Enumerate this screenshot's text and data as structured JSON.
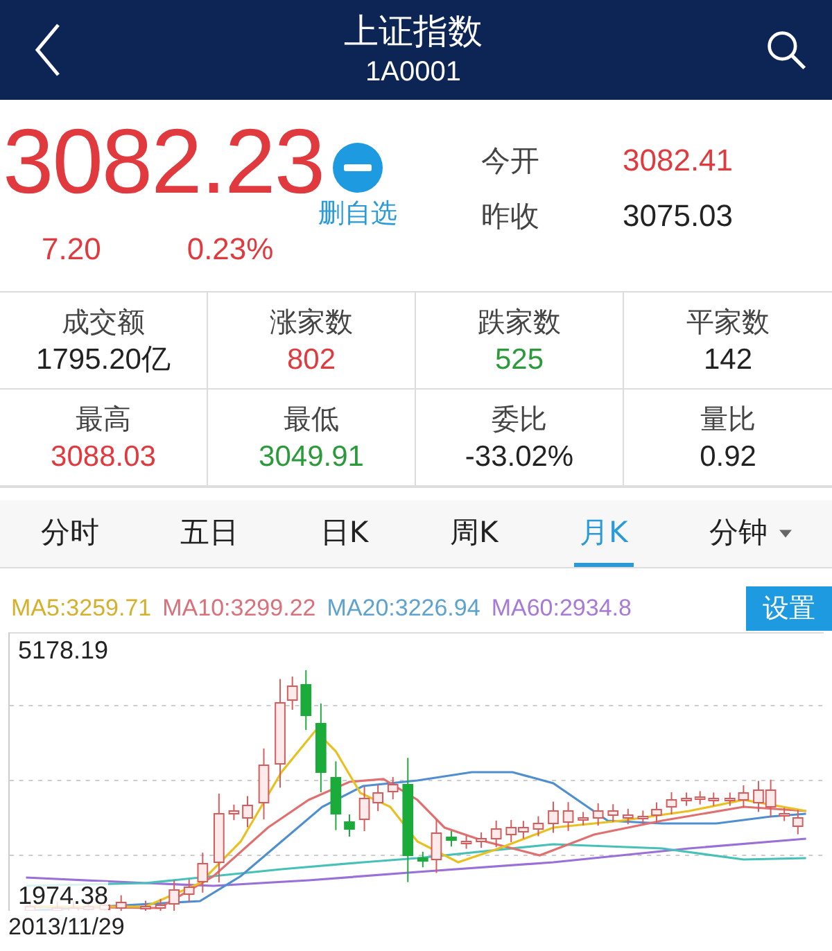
{
  "header": {
    "title": "上证指数",
    "code": "1A0001"
  },
  "quote": {
    "price": "3082.23",
    "change": "7.20",
    "change_pct": "0.23%",
    "watchlist_label": "删自选",
    "in_watchlist": true,
    "color": "#e0393e"
  },
  "side_stats": [
    {
      "label": "今开",
      "value": "3082.41",
      "color": "#e0393e"
    },
    {
      "label": "昨收",
      "value": "3075.03",
      "color": "#222222"
    }
  ],
  "stats": [
    {
      "label": "成交额",
      "value": "1795.20亿",
      "color": "#222222"
    },
    {
      "label": "涨家数",
      "value": "802",
      "color": "#e0393e"
    },
    {
      "label": "跌家数",
      "value": "525",
      "color": "#2a9a3a"
    },
    {
      "label": "平家数",
      "value": "142",
      "color": "#222222"
    },
    {
      "label": "最高",
      "value": "3088.03",
      "color": "#e0393e"
    },
    {
      "label": "最低",
      "value": "3049.91",
      "color": "#2a9a3a"
    },
    {
      "label": "委比",
      "value": "-33.02%",
      "color": "#222222"
    },
    {
      "label": "量比",
      "value": "0.92",
      "color": "#222222"
    }
  ],
  "tabs": [
    {
      "label": "分时",
      "selected": false,
      "kind": "plain"
    },
    {
      "label": "五日",
      "selected": false,
      "kind": "plain"
    },
    {
      "label": "日K",
      "selected": false,
      "kind": "plain"
    },
    {
      "label": "周K",
      "selected": false,
      "kind": "plain"
    },
    {
      "label": "月K",
      "selected": true,
      "kind": "plain"
    },
    {
      "label": "分钟",
      "selected": false,
      "kind": "dropdown"
    }
  ],
  "ma_legend": [
    {
      "label": "MA5:3259.71",
      "color": "#d4b02c"
    },
    {
      "label": "MA10:3299.22",
      "color": "#d9707a"
    },
    {
      "label": "MA20:3226.94",
      "color": "#5ea3cf"
    },
    {
      "label": "MA60:2934.8",
      "color": "#a67ad6"
    }
  ],
  "settings_button": "设置",
  "chart": {
    "max_label": "5178.19",
    "min_label": "1974.38",
    "start_date": "2013/11/29"
  }
}
